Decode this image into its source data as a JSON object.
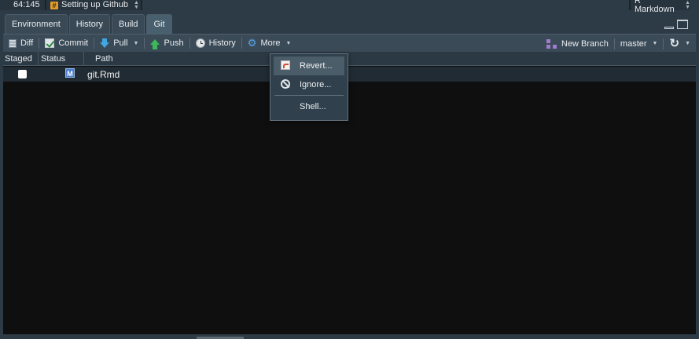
{
  "statusbar": {
    "cursor_position": "64:145",
    "section_label": "Setting up Github",
    "section_icon": "hash-icon",
    "doc_mode": "R Markdown"
  },
  "tabs": [
    {
      "label": "Environment",
      "active": false
    },
    {
      "label": "History",
      "active": false
    },
    {
      "label": "Build",
      "active": false
    },
    {
      "label": "Git",
      "active": true
    }
  ],
  "toolbar": {
    "diff_label": "Diff",
    "commit_label": "Commit",
    "pull_label": "Pull",
    "push_label": "Push",
    "history_label": "History",
    "more_label": "More",
    "new_branch_label": "New Branch",
    "branch_name": "master"
  },
  "columns": {
    "staged": "Staged",
    "status": "Status",
    "path": "Path"
  },
  "files": [
    {
      "staged": false,
      "status": "M",
      "path": "git.Rmd"
    }
  ],
  "more_menu": {
    "items": [
      {
        "label": "Revert...",
        "icon": "revert-icon"
      },
      {
        "label": "Ignore...",
        "icon": "ignore-icon"
      },
      {
        "label": "Shell...",
        "icon": ""
      }
    ]
  },
  "colors": {
    "accent_blue": "#42a7e0",
    "push_green": "#3cb85a",
    "modified_badge": "#4b7fd0",
    "hash_badge": "#e39b2b"
  }
}
